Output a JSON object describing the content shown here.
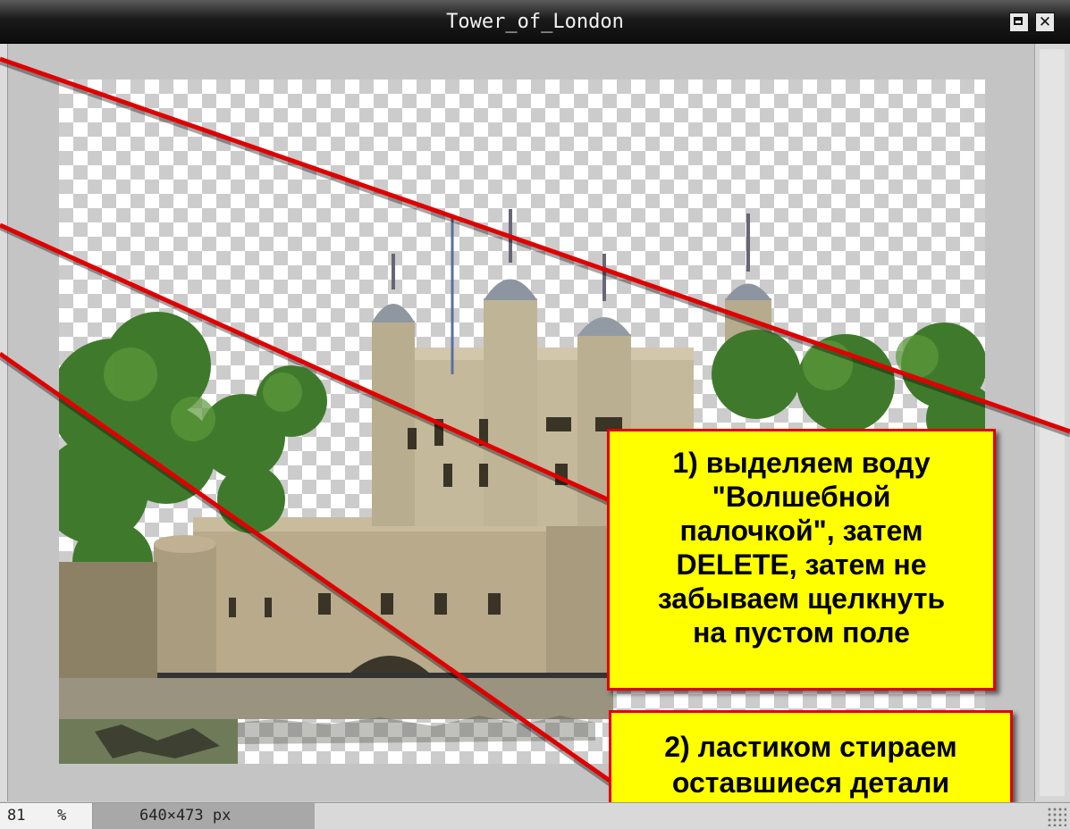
{
  "window": {
    "title": "Tower_of_London"
  },
  "status": {
    "zoom_value": "81",
    "zoom_unit": "%",
    "image_size": "640×473 px"
  },
  "callouts": {
    "step1": [
      "1) выделяем воду",
      "\"Волшебной",
      "палочкой\", затем",
      "DELETE, затем не",
      "забываем щелкнуть",
      "на пустом поле"
    ],
    "step2": [
      "2) ластиком стираем",
      "оставшиеся детали"
    ]
  },
  "icons": {
    "maximize": "maximize-icon",
    "close": "close-icon",
    "resize": "resize-grip-icon"
  },
  "colors": {
    "callout_fill": "#ffff00",
    "callout_border": "#e00000",
    "pointer_line": "#e00000"
  }
}
